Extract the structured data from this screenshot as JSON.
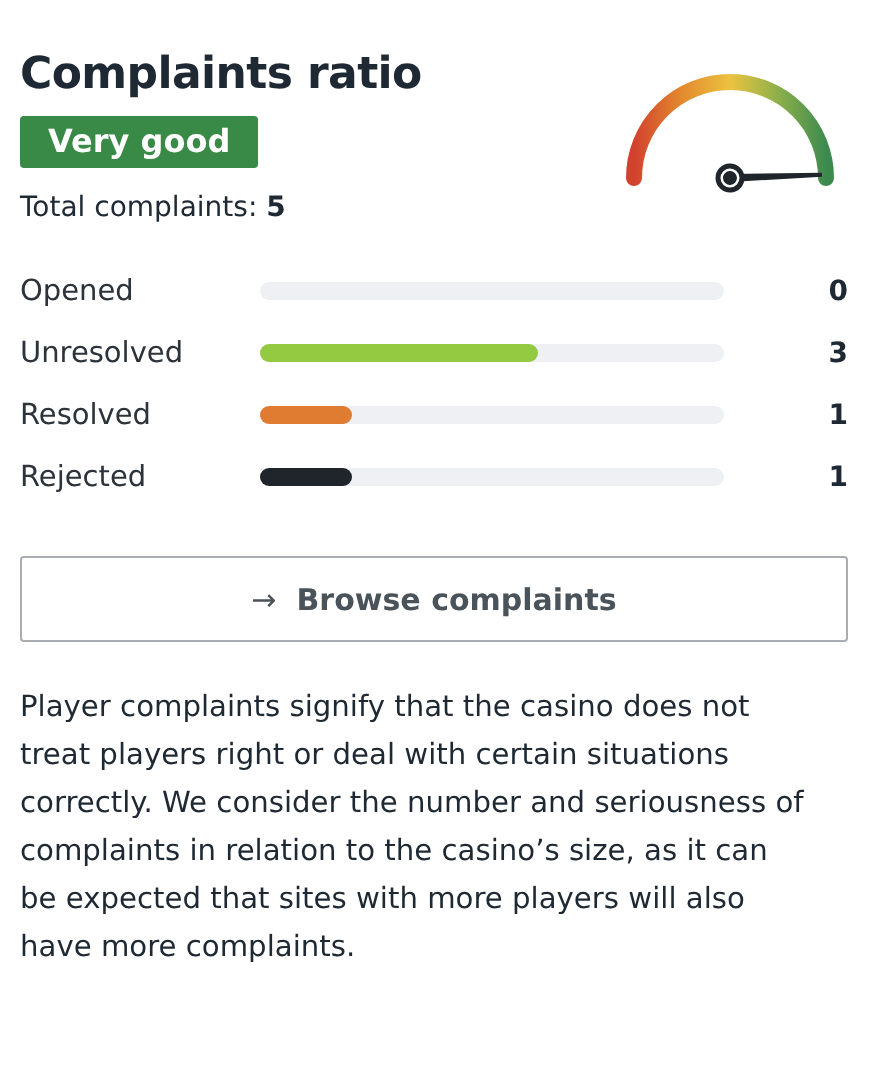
{
  "title": "Complaints ratio",
  "rating_badge": "Very good",
  "total": {
    "label": "Total complaints:",
    "value": "5"
  },
  "categories": [
    {
      "label": "Opened",
      "count": "0"
    },
    {
      "label": "Unresolved",
      "level": 0.6,
      "color": "#94c942",
      "count": "3"
    },
    {
      "label": "Resolved",
      "level": 0.2,
      "color": "#e07b32",
      "count": "1"
    },
    {
      "label": "Rejected",
      "level": 0.2,
      "color": "#1f252b",
      "count": "1"
    }
  ],
  "button": {
    "icon": "→",
    "label": "Browse complaints"
  },
  "description": "Player complaints signify that the casino does not treat players right or deal with certain situations correctly. We consider the number and seriousness of complaints in relation to the casino’s size, as it can be expected that sites with more players will also have more complaints."
}
